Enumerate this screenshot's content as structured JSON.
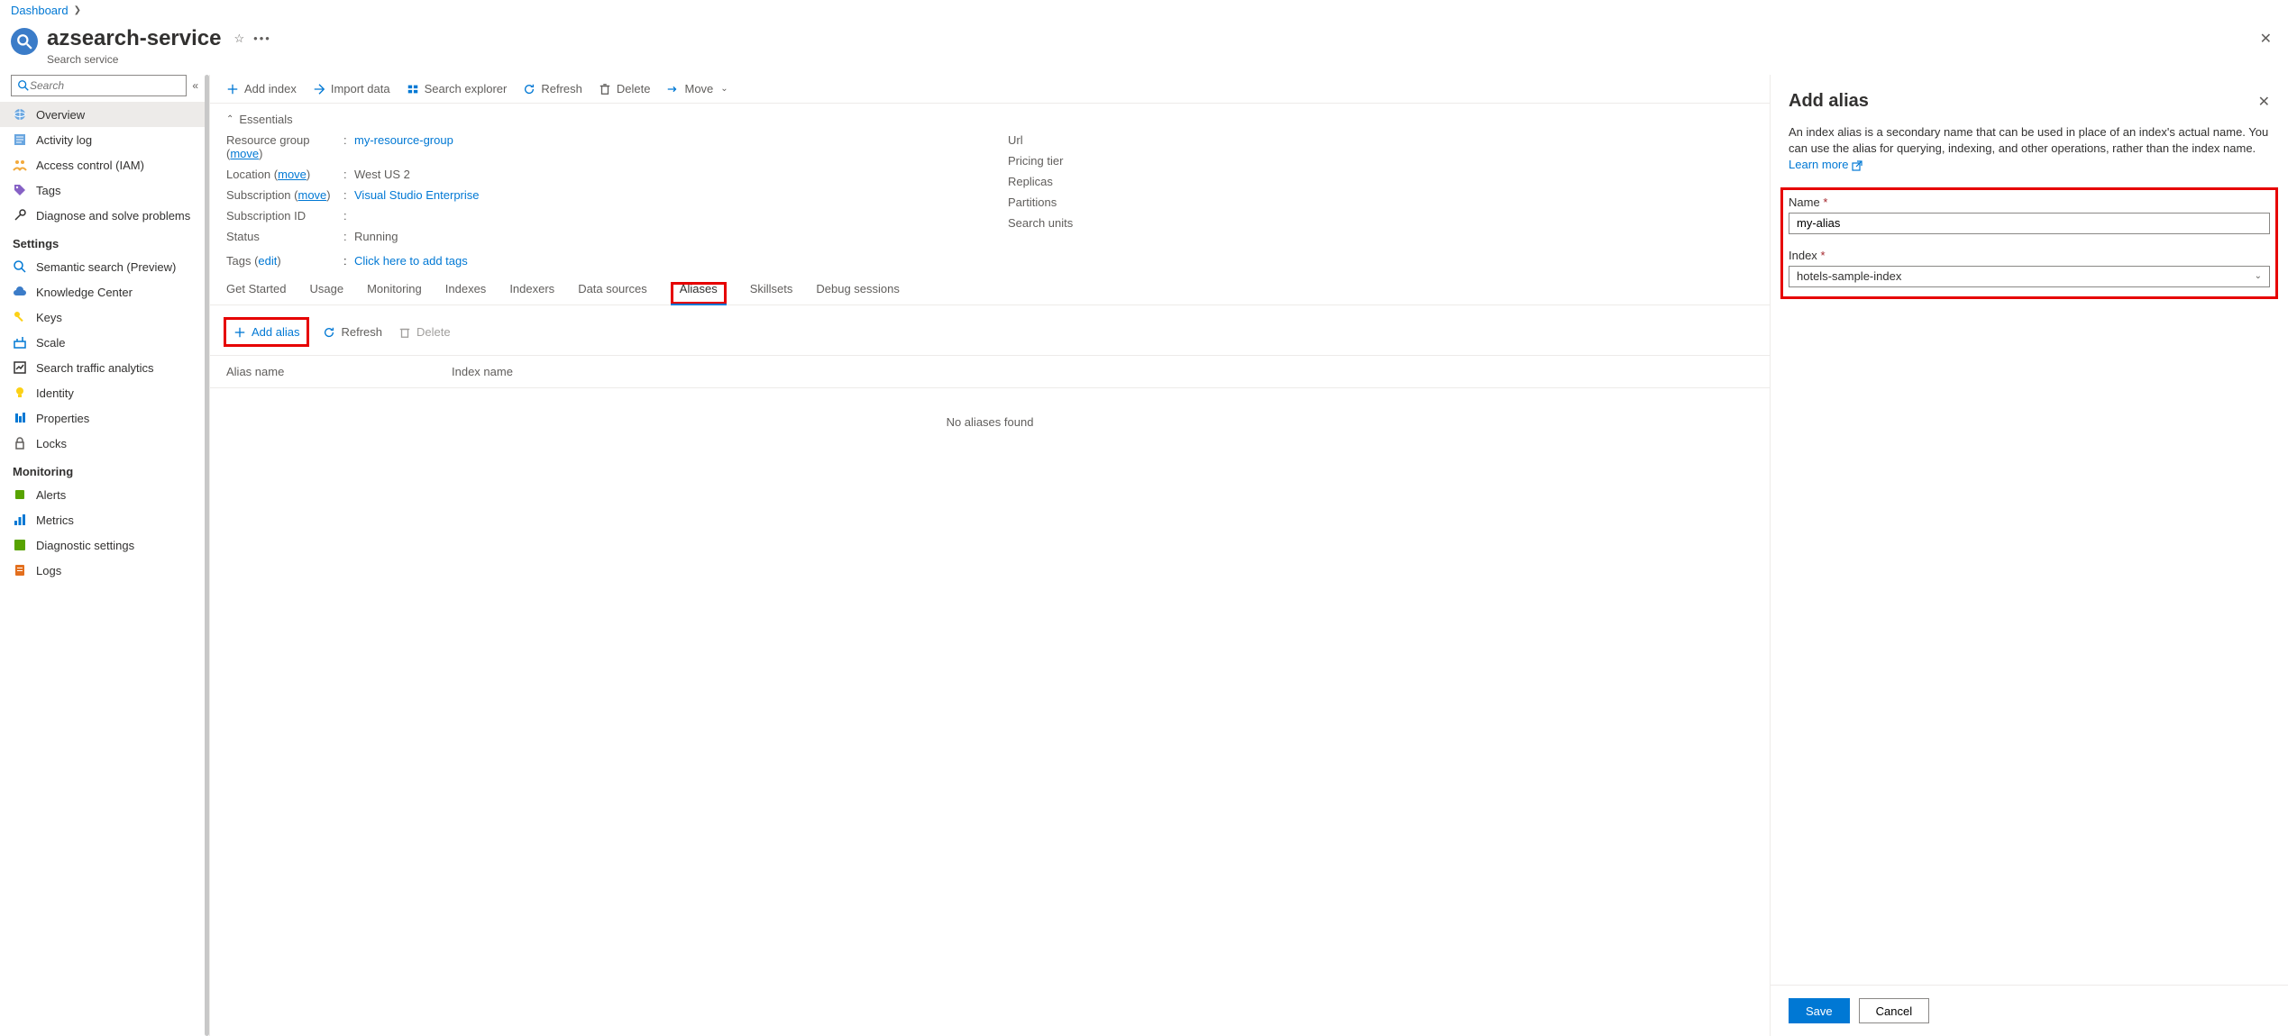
{
  "breadcrumb": {
    "root": "Dashboard"
  },
  "header": {
    "title": "azsearch-service",
    "subtitle": "Search service"
  },
  "search": {
    "placeholder": "Search"
  },
  "sidebar": {
    "items": [
      {
        "label": "Overview",
        "icon": "globe",
        "selected": true
      },
      {
        "label": "Activity log",
        "icon": "log"
      },
      {
        "label": "Access control (IAM)",
        "icon": "people"
      },
      {
        "label": "Tags",
        "icon": "tag"
      },
      {
        "label": "Diagnose and solve problems",
        "icon": "wrench"
      }
    ],
    "section_settings": "Settings",
    "settings": [
      {
        "label": "Semantic search (Preview)",
        "icon": "search"
      },
      {
        "label": "Knowledge Center",
        "icon": "cloud"
      },
      {
        "label": "Keys",
        "icon": "key"
      },
      {
        "label": "Scale",
        "icon": "scale"
      },
      {
        "label": "Search traffic analytics",
        "icon": "chart"
      },
      {
        "label": "Identity",
        "icon": "bulb"
      },
      {
        "label": "Properties",
        "icon": "props"
      },
      {
        "label": "Locks",
        "icon": "lock"
      }
    ],
    "section_monitoring": "Monitoring",
    "monitoring": [
      {
        "label": "Alerts",
        "icon": "alert"
      },
      {
        "label": "Metrics",
        "icon": "metrics"
      },
      {
        "label": "Diagnostic settings",
        "icon": "diag"
      },
      {
        "label": "Logs",
        "icon": "logs"
      }
    ]
  },
  "toolbar": {
    "add_index": "Add index",
    "import_data": "Import data",
    "search_explorer": "Search explorer",
    "refresh": "Refresh",
    "delete": "Delete",
    "move": "Move"
  },
  "essentials": {
    "header": "Essentials",
    "move_label": "move",
    "edit_label": "edit",
    "left": {
      "resource_group_k": "Resource group",
      "resource_group_v": "my-resource-group",
      "location_k": "Location",
      "location_v": "West US 2",
      "subscription_k": "Subscription",
      "subscription_v": "Visual Studio Enterprise",
      "subscription_id_k": "Subscription ID",
      "subscription_id_v": "",
      "status_k": "Status",
      "status_v": "Running"
    },
    "right": {
      "url_k": "Url",
      "pricing_k": "Pricing tier",
      "replicas_k": "Replicas",
      "partitions_k": "Partitions",
      "search_units_k": "Search units"
    },
    "tags_k": "Tags",
    "tags_action": "Click here to add tags"
  },
  "tabs": {
    "items": [
      "Get Started",
      "Usage",
      "Monitoring",
      "Indexes",
      "Indexers",
      "Data sources",
      "Aliases",
      "Skillsets",
      "Debug sessions"
    ],
    "active": "Aliases"
  },
  "subtoolbar": {
    "add_alias": "Add alias",
    "refresh": "Refresh",
    "delete": "Delete"
  },
  "table": {
    "col_alias": "Alias name",
    "col_index": "Index name",
    "empty": "No aliases found"
  },
  "panel": {
    "title": "Add alias",
    "desc": "An index alias is a secondary name that can be used in place of an index's actual name. You can use the alias for querying, indexing, and other operations, rather than the index name.",
    "learn_more": "Learn more",
    "name_label": "Name",
    "name_value": "my-alias",
    "index_label": "Index",
    "index_value": "hotels-sample-index",
    "save": "Save",
    "cancel": "Cancel"
  }
}
